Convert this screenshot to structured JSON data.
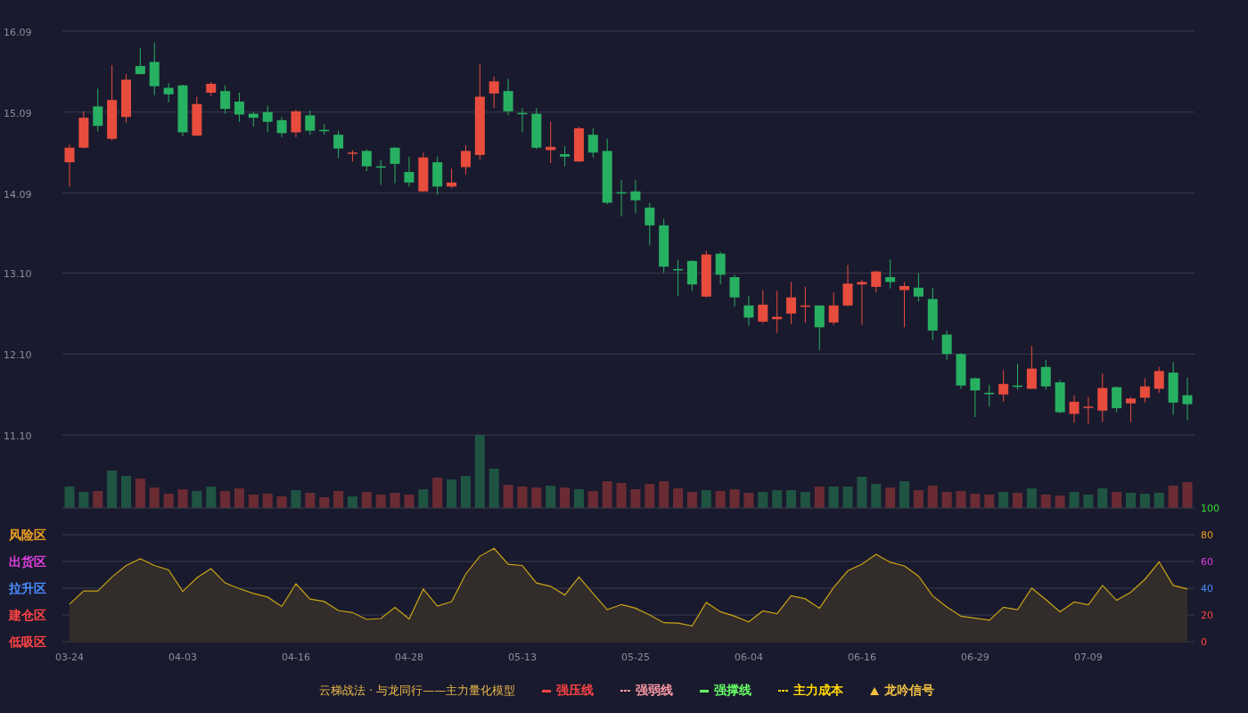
{
  "price_chart": {
    "chart_data": {
      "type": "candlestick",
      "grid": true,
      "ylim": [
        11.1,
        16.09
      ],
      "yticks": [
        {
          "value": 16.09,
          "label": "16.09"
        },
        {
          "value": 15.09,
          "label": "15.09"
        },
        {
          "value": 14.09,
          "label": "14.09"
        },
        {
          "value": 13.1,
          "label": "13.10"
        },
        {
          "value": 12.1,
          "label": "12.10"
        },
        {
          "value": 11.1,
          "label": "11.10"
        }
      ],
      "categories": [
        null,
        null,
        null,
        null,
        null,
        null,
        null,
        null,
        null,
        null,
        null,
        null,
        null,
        null,
        null,
        null,
        null,
        null,
        null,
        null,
        null,
        null,
        null,
        null,
        null,
        null,
        null,
        null,
        null,
        null,
        null,
        null,
        null,
        null,
        null,
        null,
        null,
        null,
        null,
        null,
        null,
        null,
        null,
        null,
        null,
        null,
        null,
        null,
        null,
        null,
        null,
        null,
        null,
        null,
        null,
        null,
        null,
        null,
        null,
        null,
        null,
        null,
        null,
        null,
        null,
        null,
        null,
        null,
        null,
        null,
        null,
        null,
        null,
        null,
        null,
        null,
        null,
        null,
        null,
        null
      ],
      "ohlc": [
        [
          14.47,
          14.69,
          14.17,
          14.65
        ],
        [
          14.65,
          15.1,
          14.64,
          15.02
        ],
        [
          15.16,
          15.38,
          14.85,
          14.92
        ],
        [
          14.76,
          15.67,
          14.74,
          15.24
        ],
        [
          15.03,
          15.56,
          14.96,
          15.49
        ],
        [
          15.66,
          15.88,
          15.56,
          15.56
        ],
        [
          15.71,
          15.95,
          15.3,
          15.41
        ],
        [
          15.39,
          15.45,
          15.21,
          15.31
        ],
        [
          15.42,
          15.43,
          14.79,
          14.84
        ],
        [
          14.8,
          15.28,
          14.79,
          15.19
        ],
        [
          15.33,
          15.46,
          15.29,
          15.44
        ],
        [
          15.35,
          15.42,
          15.07,
          15.13
        ],
        [
          15.22,
          15.33,
          14.97,
          15.06
        ],
        [
          15.07,
          15.09,
          14.91,
          15.02
        ],
        [
          15.09,
          15.17,
          14.84,
          14.97
        ],
        [
          14.99,
          15.03,
          14.78,
          14.83
        ],
        [
          14.84,
          15.12,
          14.78,
          15.1
        ],
        [
          15.05,
          15.11,
          14.81,
          14.86
        ],
        [
          14.87,
          14.94,
          14.81,
          14.86
        ],
        [
          14.81,
          14.86,
          14.52,
          14.64
        ],
        [
          14.58,
          14.62,
          14.48,
          14.59
        ],
        [
          14.61,
          14.63,
          14.36,
          14.42
        ],
        [
          14.42,
          14.5,
          14.19,
          14.41
        ],
        [
          14.65,
          14.66,
          14.21,
          14.45
        ],
        [
          14.35,
          14.54,
          14.17,
          14.22
        ],
        [
          14.11,
          14.59,
          14.1,
          14.53
        ],
        [
          14.47,
          14.54,
          14.07,
          14.17
        ],
        [
          14.17,
          14.39,
          14.15,
          14.22
        ],
        [
          14.41,
          14.68,
          14.32,
          14.61
        ],
        [
          14.56,
          15.68,
          14.5,
          15.28
        ],
        [
          15.32,
          15.53,
          15.14,
          15.47
        ],
        [
          15.35,
          15.5,
          15.05,
          15.1
        ],
        [
          15.08,
          15.14,
          14.84,
          15.07
        ],
        [
          15.07,
          15.14,
          14.63,
          14.65
        ],
        [
          14.62,
          14.97,
          14.46,
          14.66
        ],
        [
          14.57,
          14.67,
          14.42,
          14.54
        ],
        [
          14.48,
          14.91,
          14.47,
          14.89
        ],
        [
          14.81,
          14.89,
          14.53,
          14.59
        ],
        [
          14.61,
          14.76,
          13.95,
          13.97
        ],
        [
          14.1,
          14.25,
          13.8,
          14.09
        ],
        [
          14.11,
          14.25,
          13.84,
          14.0
        ],
        [
          13.91,
          13.97,
          13.44,
          13.69
        ],
        [
          13.69,
          13.77,
          13.1,
          13.18
        ],
        [
          13.15,
          13.26,
          12.82,
          13.14
        ],
        [
          13.25,
          13.26,
          12.88,
          12.96
        ],
        [
          12.81,
          13.38,
          12.8,
          13.33
        ],
        [
          13.34,
          13.36,
          12.96,
          13.08
        ],
        [
          13.05,
          13.08,
          12.69,
          12.8
        ],
        [
          12.7,
          12.82,
          12.45,
          12.55
        ],
        [
          12.5,
          12.89,
          12.48,
          12.71
        ],
        [
          12.53,
          12.88,
          12.36,
          12.56
        ],
        [
          12.6,
          12.99,
          12.47,
          12.8
        ],
        [
          12.69,
          12.93,
          12.49,
          12.7
        ],
        [
          12.7,
          12.7,
          12.15,
          12.43
        ],
        [
          12.49,
          12.86,
          12.46,
          12.7
        ],
        [
          12.7,
          13.2,
          12.69,
          12.97
        ],
        [
          12.96,
          13.02,
          12.46,
          12.99
        ],
        [
          12.93,
          13.13,
          12.86,
          13.12
        ],
        [
          13.05,
          13.27,
          12.91,
          12.99
        ],
        [
          12.89,
          12.99,
          12.43,
          12.94
        ],
        [
          12.92,
          13.1,
          12.75,
          12.81
        ],
        [
          12.78,
          12.92,
          12.27,
          12.39
        ],
        [
          12.34,
          12.39,
          12.03,
          12.1
        ],
        [
          12.1,
          12.11,
          11.67,
          11.71
        ],
        [
          11.8,
          11.81,
          11.32,
          11.65
        ],
        [
          11.62,
          11.72,
          11.45,
          11.61
        ],
        [
          11.6,
          11.9,
          11.51,
          11.73
        ],
        [
          11.71,
          11.98,
          11.66,
          11.7
        ],
        [
          11.67,
          12.2,
          11.67,
          11.92
        ],
        [
          11.94,
          12.03,
          11.66,
          11.7
        ],
        [
          11.75,
          11.78,
          11.37,
          11.38
        ],
        [
          11.36,
          11.59,
          11.25,
          11.51
        ],
        [
          11.44,
          11.57,
          11.24,
          11.45
        ],
        [
          11.4,
          11.86,
          11.26,
          11.68
        ],
        [
          11.69,
          11.7,
          11.38,
          11.43
        ],
        [
          11.49,
          11.57,
          11.26,
          11.55
        ],
        [
          11.56,
          11.8,
          11.5,
          11.7
        ],
        [
          11.67,
          11.94,
          11.62,
          11.89
        ],
        [
          11.87,
          12.0,
          11.35,
          11.5
        ],
        [
          11.59,
          11.81,
          11.28,
          11.48
        ]
      ]
    }
  },
  "oscillator": {
    "chart_data": {
      "type": "area",
      "grid": true,
      "ylim": [
        0,
        100
      ],
      "yticks": [
        100,
        80,
        60,
        40,
        20,
        0
      ],
      "categories": [
        "03-24",
        null,
        null,
        null,
        null,
        null,
        null,
        null,
        "04-03",
        null,
        null,
        null,
        null,
        null,
        null,
        null,
        "04-16",
        null,
        null,
        null,
        null,
        null,
        null,
        null,
        "04-28",
        null,
        null,
        null,
        null,
        null,
        null,
        null,
        "05-13",
        null,
        null,
        null,
        null,
        null,
        null,
        null,
        "05-25",
        null,
        null,
        null,
        null,
        null,
        null,
        null,
        "06-04",
        null,
        null,
        null,
        null,
        null,
        null,
        null,
        "06-16",
        null,
        null,
        null,
        null,
        null,
        null,
        null,
        "06-29",
        null,
        null,
        null,
        null,
        null,
        null,
        null,
        "07-09",
        null,
        null,
        null,
        null,
        null,
        null,
        null
      ],
      "series": [
        {
          "color": "#c9a516",
          "values": [
            28.1,
            37.9,
            37.9,
            48.4,
            57,
            62.1,
            57,
            53.7,
            37.6,
            47.8,
            54.6,
            43.9,
            39.7,
            36.1,
            33.4,
            26.3,
            43.3,
            31.9,
            30.1,
            23.3,
            21.8,
            16.7,
            17.3,
            25.7,
            17,
            39.4,
            26.6,
            29.9,
            50.7,
            63.9,
            69.8,
            57.9,
            57,
            43.9,
            41.5,
            34.9,
            48.4,
            36.1,
            23.9,
            27.8,
            25.1,
            20,
            14.2,
            13.9,
            11.8,
            29.4,
            22.4,
            19.1,
            14.8,
            23,
            20.9,
            34.5,
            32.1,
            25.1,
            40.6,
            53,
            57.9,
            65.4,
            59.4,
            56.7,
            49.1,
            34.2,
            26.1,
            19.1,
            17.6,
            16.1,
            25.8,
            23.9,
            40,
            31.5,
            22.4,
            29.7,
            27.6,
            42.1,
            30.9,
            37,
            46.7,
            59.7,
            42.1,
            39.4
          ]
        }
      ]
    },
    "tick_labels": [
      {
        "label": "100",
        "color": "#33dd33"
      },
      {
        "label": "80",
        "color": "#f0a020"
      },
      {
        "label": "60",
        "color": "#e040e0"
      },
      {
        "label": "40",
        "color": "#4a8cff"
      },
      {
        "label": "20",
        "color": "#ff4444"
      },
      {
        "label": "0",
        "color": "#ff4444"
      }
    ],
    "zones": [
      {
        "label": "风险区",
        "color": "#f0a020"
      },
      {
        "label": "出货区",
        "color": "#e040e0"
      },
      {
        "label": "拉升区",
        "color": "#4a8cff"
      },
      {
        "label": "建仓区",
        "color": "#ff4444"
      },
      {
        "label": "低吸区",
        "color": "#ff4444"
      }
    ]
  },
  "legend": {
    "title": "云梯战法 · 与龙同行——主力量化模型",
    "items": [
      {
        "label": "强压线",
        "kind": "solid",
        "color": "#ff4444"
      },
      {
        "label": "强弱线",
        "kind": "dashed",
        "color": "#ff9aa6"
      },
      {
        "label": "强撑线",
        "kind": "solid",
        "color": "#66ff66"
      },
      {
        "label": "主力成本",
        "kind": "dashed",
        "color": "#ffd700"
      },
      {
        "label": "龙吟信号",
        "kind": "triangle",
        "color": "#f0c040"
      }
    ]
  }
}
